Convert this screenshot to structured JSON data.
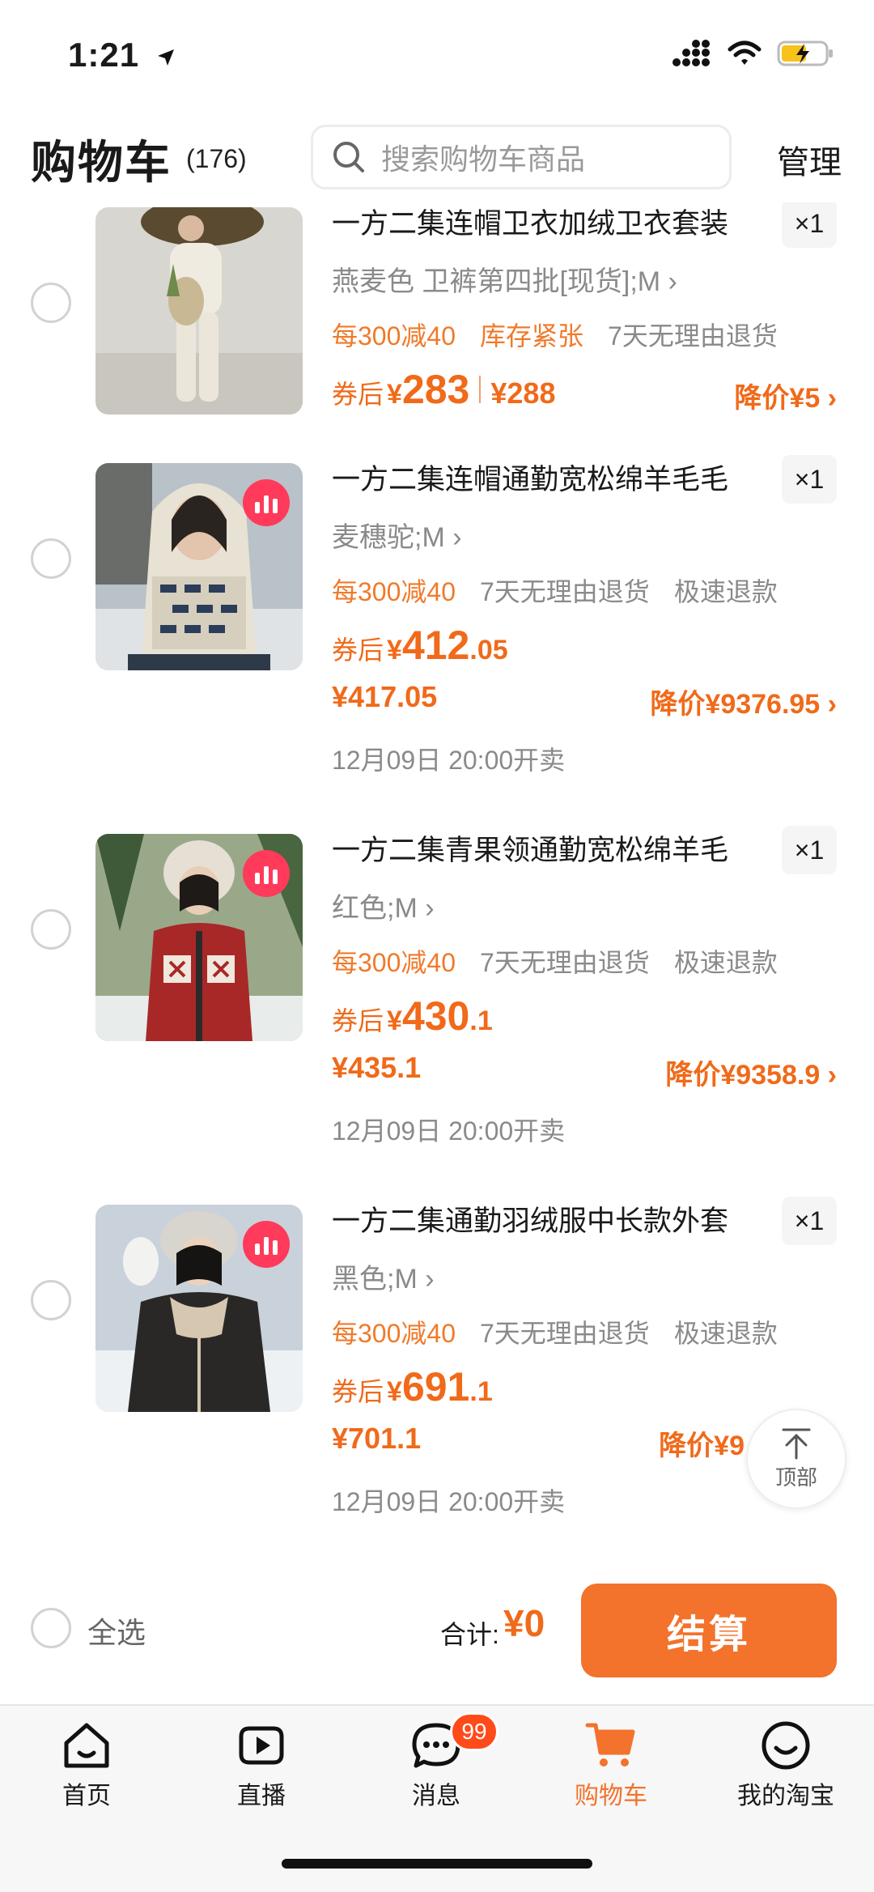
{
  "status": {
    "time": "1:21"
  },
  "header": {
    "title": "购物车",
    "count": "(176)",
    "search_placeholder": "搜索购物车商品",
    "manage": "管理"
  },
  "items": [
    {
      "name": "一方二集连帽卫衣加绒卫衣套装",
      "qty": "×1",
      "sku": "燕麦色 卫裤第四批[现货];M ›",
      "tags": [
        "每300减40",
        "库存紧张",
        "7天无理由退货"
      ],
      "after_label": "券后",
      "yen": "¥",
      "price_int": "283",
      "price_dec": "",
      "orig_price": "¥288",
      "drop": "降价¥5 ›"
    },
    {
      "name": "一方二集连帽通勤宽松绵羊毛毛",
      "qty": "×1",
      "sku": "麦穗驼;M ›",
      "tags": [
        "每300减40",
        "7天无理由退货",
        "极速退款"
      ],
      "after_label": "券后",
      "yen": "¥",
      "price_int": "412",
      "price_dec": ".05",
      "orig_price": "¥417.05",
      "drop": "降价¥9376.95 ›",
      "sale_time": "12月09日 20:00开卖"
    },
    {
      "name": "一方二集青果领通勤宽松绵羊毛",
      "qty": "×1",
      "sku": "红色;M ›",
      "tags": [
        "每300减40",
        "7天无理由退货",
        "极速退款"
      ],
      "after_label": "券后",
      "yen": "¥",
      "price_int": "430",
      "price_dec": ".1",
      "orig_price": "¥435.1",
      "drop": "降价¥9358.9 ›",
      "sale_time": "12月09日 20:00开卖"
    },
    {
      "name": "一方二集通勤羽绒服中长款外套",
      "qty": "×1",
      "sku": "黑色;M ›",
      "tags": [
        "每300减40",
        "7天无理由退货",
        "极速退款"
      ],
      "after_label": "券后",
      "yen": "¥",
      "price_int": "691",
      "price_dec": ".1",
      "orig_price": "¥701.1",
      "drop": "降价¥9",
      "sale_time": "12月09日 20:00开卖"
    }
  ],
  "top_button": "顶部",
  "checkout": {
    "select_all": "全选",
    "total_label": "合计:",
    "total_value": "¥0",
    "button": "结算"
  },
  "tabbar": {
    "home": "首页",
    "live": "直播",
    "messages": "消息",
    "messages_badge": "99",
    "cart": "购物车",
    "mine": "我的淘宝"
  },
  "colors": {
    "accent": "#f3722c",
    "price": "#f06a1a",
    "badge": "#ff4a1a"
  }
}
